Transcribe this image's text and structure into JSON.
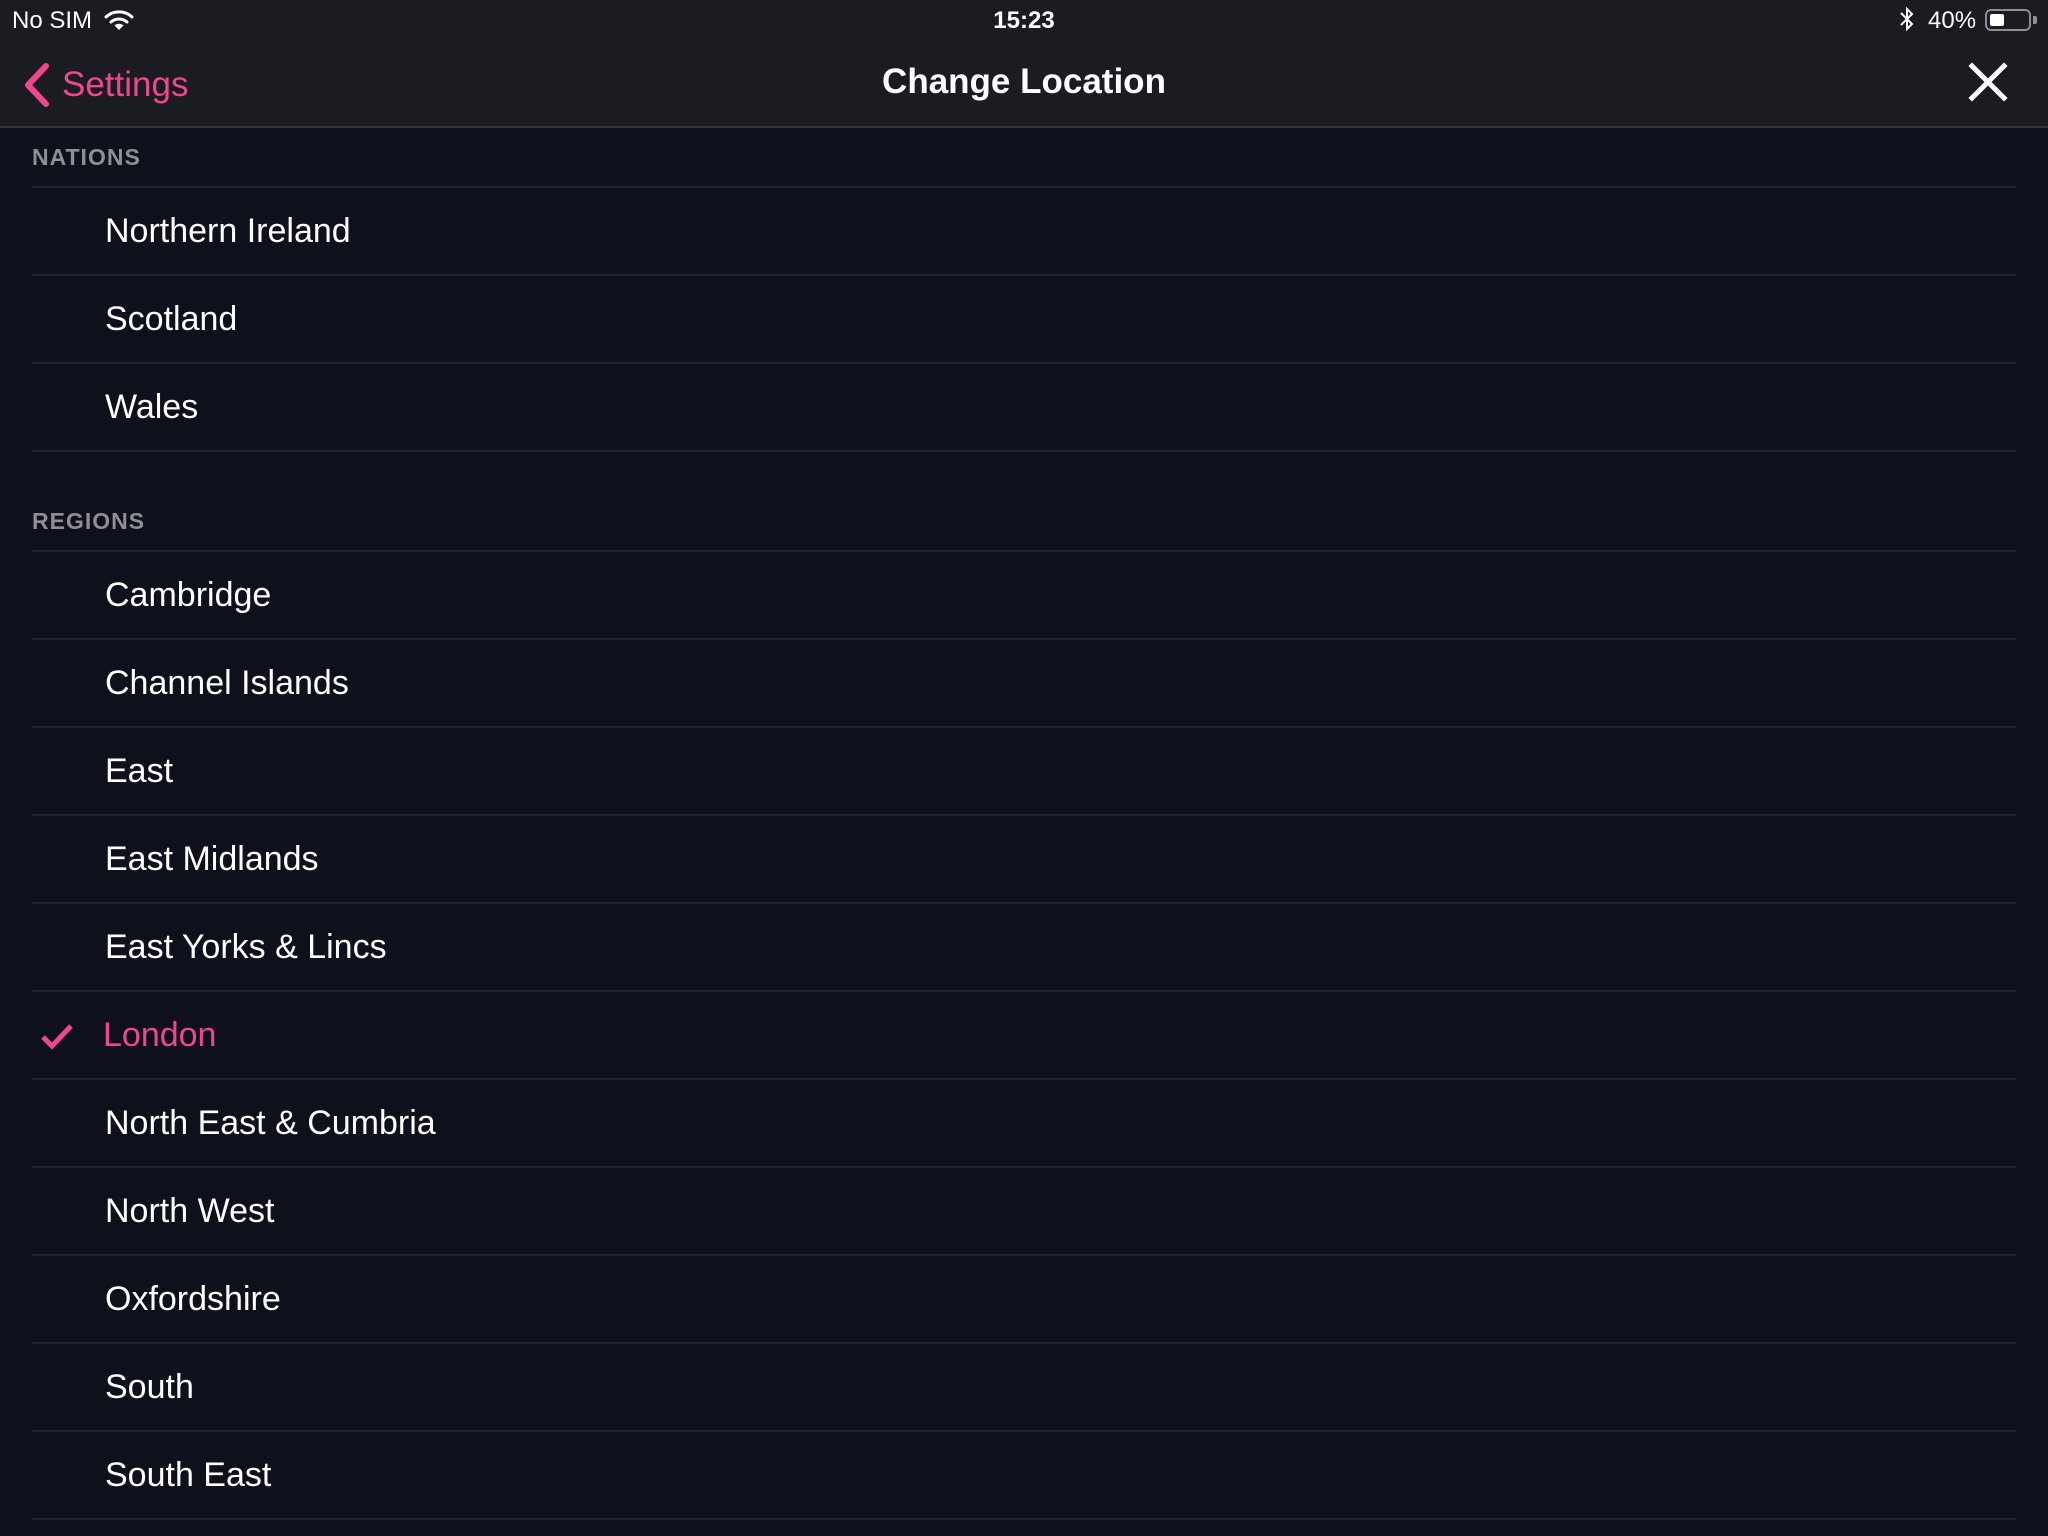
{
  "status_bar": {
    "carrier": "No SIM",
    "time": "15:23",
    "battery_percent": "40%",
    "battery_level": 0.4,
    "wifi_icon": "wifi-icon",
    "bluetooth_icon": "bluetooth-icon"
  },
  "nav": {
    "back_label": "Settings",
    "title": "Change Location",
    "close_icon": "close-icon"
  },
  "accent_color": "#f0468f",
  "sections": [
    {
      "header": "NATIONS",
      "items": [
        {
          "label": "Northern Ireland",
          "selected": false
        },
        {
          "label": "Scotland",
          "selected": false
        },
        {
          "label": "Wales",
          "selected": false
        }
      ]
    },
    {
      "header": "REGIONS",
      "items": [
        {
          "label": "Cambridge",
          "selected": false
        },
        {
          "label": "Channel Islands",
          "selected": false
        },
        {
          "label": "East",
          "selected": false
        },
        {
          "label": "East Midlands",
          "selected": false
        },
        {
          "label": "East Yorks & Lincs",
          "selected": false
        },
        {
          "label": "London",
          "selected": true
        },
        {
          "label": "North East & Cumbria",
          "selected": false
        },
        {
          "label": "North West",
          "selected": false
        },
        {
          "label": "Oxfordshire",
          "selected": false
        },
        {
          "label": "South",
          "selected": false
        },
        {
          "label": "South East",
          "selected": false
        }
      ]
    }
  ]
}
